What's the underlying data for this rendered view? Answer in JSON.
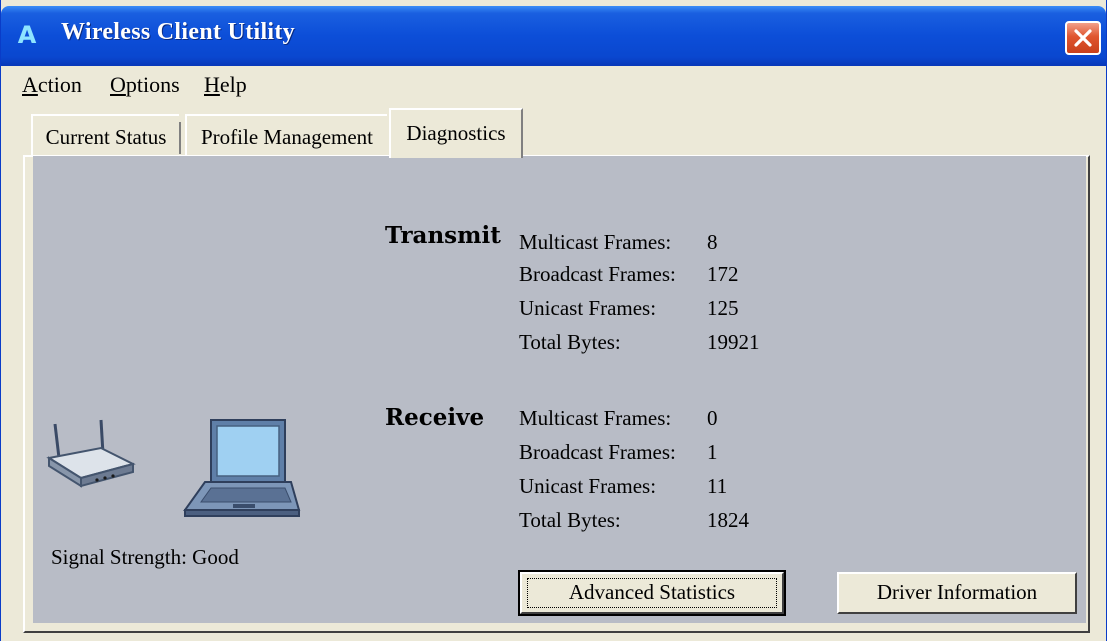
{
  "window": {
    "title": "Wireless Client Utility",
    "app_icon": "A"
  },
  "menu": [
    {
      "mnemonic": "A",
      "rest": "ction"
    },
    {
      "mnemonic": "O",
      "rest": "ptions"
    },
    {
      "mnemonic": "H",
      "rest": "elp"
    }
  ],
  "tabs": [
    {
      "label": "Current Status",
      "active": false
    },
    {
      "label": "Profile Management",
      "active": false
    },
    {
      "label": "Diagnostics",
      "active": true
    }
  ],
  "transmit": {
    "title": "Transmit",
    "rows": [
      {
        "label": "Multicast Frames:",
        "value": "8"
      },
      {
        "label": "Broadcast Frames:",
        "value": "172"
      },
      {
        "label": "Unicast Frames:",
        "value": "125"
      },
      {
        "label": "Total Bytes:",
        "value": "19921"
      }
    ]
  },
  "receive": {
    "title": "Receive",
    "rows": [
      {
        "label": "Multicast Frames:",
        "value": "0"
      },
      {
        "label": "Broadcast Frames:",
        "value": "1"
      },
      {
        "label": "Unicast Frames:",
        "value": "11"
      },
      {
        "label": "Total Bytes:",
        "value": "1824"
      }
    ]
  },
  "signal": {
    "label": "Signal Strength:",
    "value": "Good"
  },
  "buttons": {
    "advanced": "Advanced Statistics",
    "driver": "Driver Information"
  },
  "colors": {
    "titlebar": "#0c4ed8",
    "panel": "#b8bcc6",
    "window": "#ece9d8",
    "close": "#e0552f"
  },
  "icons": {
    "router": "router-icon",
    "laptop": "laptop-icon",
    "close": "close-icon"
  }
}
